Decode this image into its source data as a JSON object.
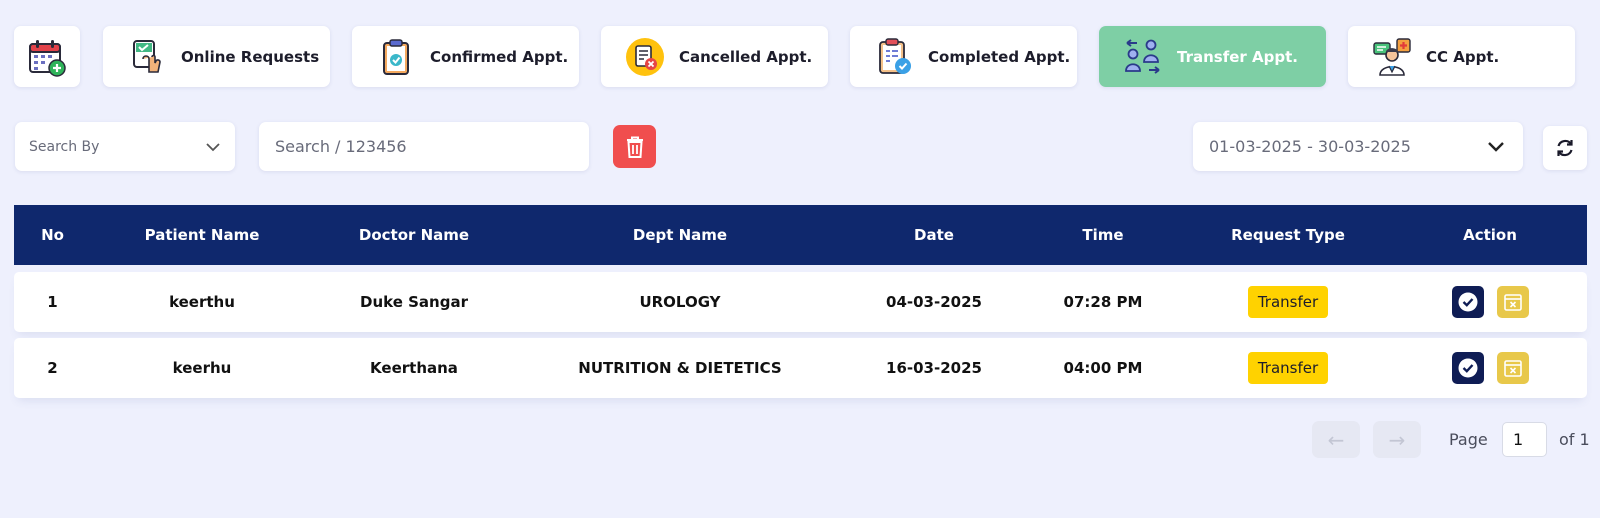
{
  "tabs": [
    {
      "name": "calendar-add",
      "label": "",
      "icon": "calendar-add-icon"
    },
    {
      "name": "online-requests",
      "label": "Online Requests",
      "icon": "online-request-icon"
    },
    {
      "name": "confirmed",
      "label": "Confirmed Appt.",
      "icon": "clipboard-check-icon"
    },
    {
      "name": "cancelled",
      "label": "Cancelled Appt.",
      "icon": "cancel-document-icon"
    },
    {
      "name": "completed",
      "label": "Completed Appt.",
      "icon": "checklist-icon"
    },
    {
      "name": "transfer",
      "label": "Transfer Appt.",
      "icon": "transfer-users-icon",
      "active": true
    },
    {
      "name": "cc",
      "label": "CC Appt.",
      "icon": "doctor-consult-icon"
    }
  ],
  "filters": {
    "search_by": "Search By",
    "search_placeholder": "Search / 123456",
    "date_range": "01-03-2025 - 30-03-2025"
  },
  "table": {
    "headers": [
      "No",
      "Patient Name",
      "Doctor Name",
      "Dept Name",
      "Date",
      "Time",
      "Request Type",
      "Action"
    ],
    "rows": [
      {
        "no": "1",
        "patient": "keerthu",
        "doctor": "Duke Sangar",
        "dept": "UROLOGY",
        "date": "04-03-2025",
        "time": "07:28 PM",
        "request_type": "Transfer"
      },
      {
        "no": "2",
        "patient": "keerhu",
        "doctor": "Keerthana",
        "dept": "NUTRITION & DIETETICS",
        "date": "16-03-2025",
        "time": "04:00 PM",
        "request_type": "Transfer"
      }
    ]
  },
  "pagination": {
    "prev": "←",
    "next": "→",
    "page_label": "Page",
    "current": "1",
    "of_label": "of 1"
  },
  "colors": {
    "background": "#eef0fd",
    "header": "#0f286d",
    "active_tab": "#7ecfa5",
    "badge": "#ffd200",
    "delete": "#f04e4e"
  }
}
